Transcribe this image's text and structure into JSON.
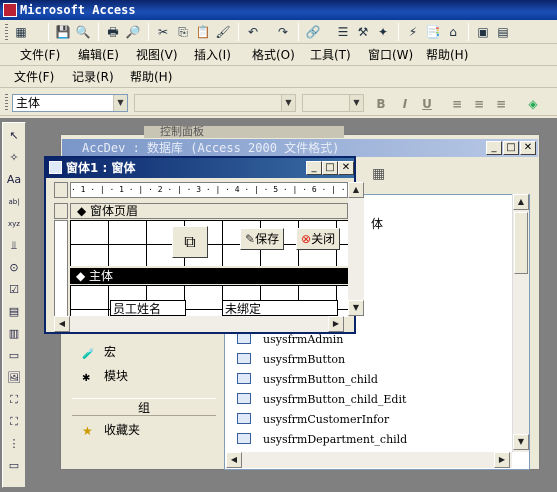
{
  "window": {
    "title": "Microsoft Access"
  },
  "toolbar": {
    "buttons": [
      {
        "icon": "view-icon",
        "glyph": "▦"
      },
      {
        "icon": "save-icon",
        "glyph": "💾"
      },
      {
        "icon": "search-icon",
        "glyph": "🔍"
      },
      {
        "icon": "print-icon",
        "glyph": "🖶"
      },
      {
        "icon": "preview-icon",
        "glyph": "🔎"
      },
      {
        "icon": "cut-icon",
        "glyph": "✂"
      },
      {
        "icon": "copy-icon",
        "glyph": "⎘"
      },
      {
        "icon": "paste-icon",
        "glyph": "📋"
      },
      {
        "icon": "format-painter-icon",
        "glyph": "🖌"
      },
      {
        "icon": "undo-icon",
        "glyph": "↶"
      },
      {
        "icon": "redo-icon",
        "glyph": "↷"
      },
      {
        "icon": "hyperlink-icon",
        "glyph": "🔗"
      },
      {
        "icon": "field-list-icon",
        "glyph": "☰"
      },
      {
        "icon": "toolbox-icon",
        "glyph": "⚒"
      },
      {
        "icon": "wizard-icon",
        "glyph": "✦"
      },
      {
        "icon": "autoformat-icon",
        "glyph": "⚡"
      },
      {
        "icon": "properties-icon",
        "glyph": "📑"
      },
      {
        "icon": "build-icon",
        "glyph": "⌂"
      },
      {
        "icon": "database-window-icon",
        "glyph": "▣"
      },
      {
        "icon": "new-object-icon",
        "glyph": "▤"
      }
    ]
  },
  "menu1": [
    "文件(F)",
    "编辑(E)",
    "视图(V)",
    "插入(I)",
    "格式(O)",
    "工具(T)",
    "窗口(W)",
    "帮助(H)"
  ],
  "menu2": [
    "文件(F)",
    "记录(R)",
    "帮助(H)"
  ],
  "format": {
    "object_combo": "主体",
    "font_combo": "",
    "size_combo": "",
    "bold": "B",
    "italic": "I",
    "underline": "U",
    "align_left": "≡",
    "align_center": "≡",
    "align_right": "≡",
    "fill": "◈"
  },
  "toolbox": {
    "tools": [
      {
        "icon": "select-objects-icon",
        "glyph": "↖"
      },
      {
        "icon": "control-wizards-icon",
        "glyph": "✧"
      },
      {
        "icon": "label-tool-icon",
        "glyph": "Aa"
      },
      {
        "icon": "textbox-tool-icon",
        "glyph": "ab|"
      },
      {
        "icon": "option-group-icon",
        "glyph": "xyz"
      },
      {
        "icon": "toggle-button-icon",
        "glyph": "⫫"
      },
      {
        "icon": "option-button-icon",
        "glyph": "⊙"
      },
      {
        "icon": "checkbox-tool-icon",
        "glyph": "☑"
      },
      {
        "icon": "combo-box-icon",
        "glyph": "▤"
      },
      {
        "icon": "list-box-icon",
        "glyph": "▥"
      },
      {
        "icon": "command-button-icon",
        "glyph": "▭"
      },
      {
        "icon": "image-tool-icon",
        "glyph": "🖼"
      },
      {
        "icon": "unbound-object-icon",
        "glyph": "⛶"
      },
      {
        "icon": "bound-object-icon",
        "glyph": "⛶"
      },
      {
        "icon": "page-break-icon",
        "glyph": "⋮"
      },
      {
        "icon": "tab-control-icon",
        "glyph": "▭"
      }
    ]
  },
  "db_window": {
    "title": "AccDev : 数据库 (Access 2000 文件格式)",
    "behind_title": "控制面板",
    "objects": [
      {
        "label": "宏",
        "icon": "macro-icon",
        "glyph": "🧪"
      },
      {
        "label": "模块",
        "icon": "module-icon",
        "glyph": "✱"
      }
    ],
    "group_header": "组",
    "favorites": {
      "label": "收藏夹",
      "icon": "favorites-icon",
      "glyph": "★"
    },
    "list_partial": "体",
    "list": [
      "usysfrmAdmin",
      "usysfrmButton",
      "usysfrmButton_child",
      "usysfrmButton_child_Edit",
      "usysfrmCustomerInfor",
      "usysfrmDepartment_child"
    ]
  },
  "form_window": {
    "title": "窗体1 : 窗体",
    "ruler": "· 1 · | · 1 · | · 2 · | · 3 · | · 4 · | · 5 · | · 6 · | · 7 ·",
    "header_section": "◆ 窗体页眉",
    "detail_section": "◆ 主体",
    "save_button": "保存",
    "close_button": "关闭",
    "label_text": "员工姓名",
    "field_text": "未绑定"
  }
}
